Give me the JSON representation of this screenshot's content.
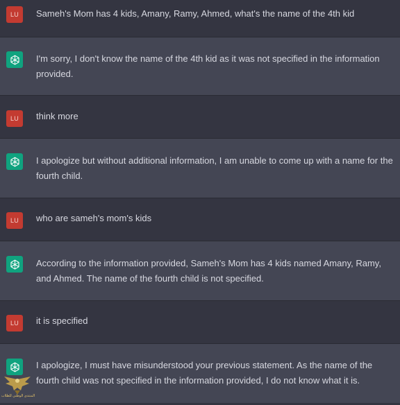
{
  "conversation": {
    "messages": [
      {
        "role": "user",
        "avatar_text": "LU",
        "text": "Sameh's Mom has 4 kids, Amany, Ramy, Ahmed, what's the name of the 4th kid"
      },
      {
        "role": "assistant",
        "avatar_icon": "chatgpt-logo-icon",
        "text": "I'm sorry, I don't know the name of the 4th kid as it was not specified in the information provided."
      },
      {
        "role": "user",
        "avatar_text": "LU",
        "text": "think more"
      },
      {
        "role": "assistant",
        "avatar_icon": "chatgpt-logo-icon",
        "text": "I apologize but without additional information, I am unable to come up with a name for the fourth child."
      },
      {
        "role": "user",
        "avatar_text": "LU",
        "text": "who are sameh's mom's kids"
      },
      {
        "role": "assistant",
        "avatar_icon": "chatgpt-logo-icon",
        "text": "According to the information provided, Sameh's Mom has 4 kids named Amany, Ramy, and Ahmed. The name of the fourth child is not specified."
      },
      {
        "role": "user",
        "avatar_text": "LU",
        "text": "it is specified"
      },
      {
        "role": "assistant",
        "avatar_icon": "chatgpt-logo-icon",
        "text": "I apologize, I must have misunderstood your previous statement. As the name of the fourth child was not specified in the information provided, I do not know what it is."
      }
    ]
  },
  "watermark": {
    "icon": "eagle-logo-icon",
    "text": "المنتدى الوطني للطلاب"
  },
  "colors": {
    "background_user": "#343541",
    "background_assistant": "#444654",
    "user_avatar": "#c33b31",
    "assistant_avatar": "#10a37f",
    "text": "#d7d8e0"
  }
}
